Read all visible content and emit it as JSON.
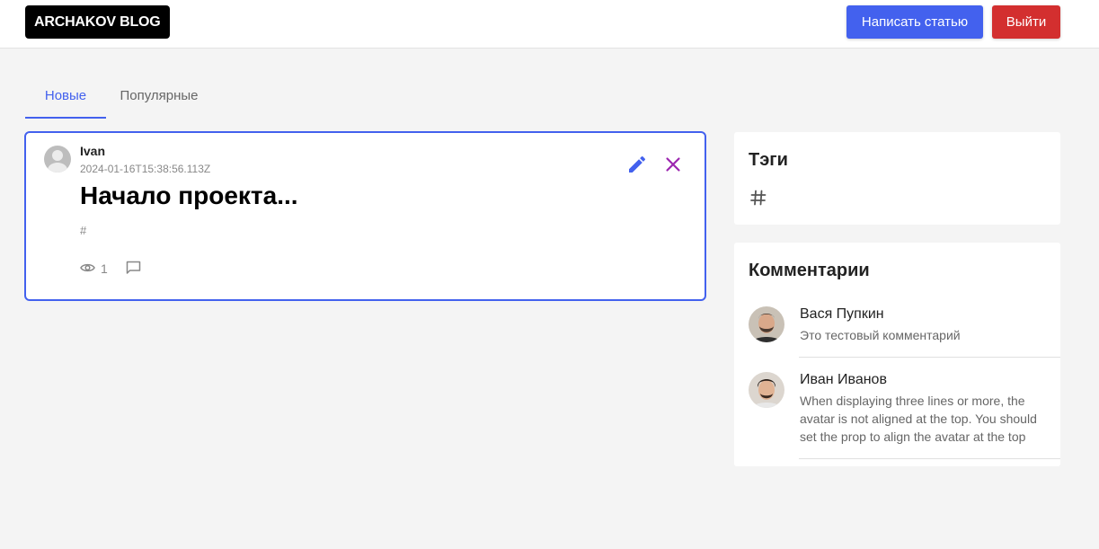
{
  "header": {
    "logo": "ARCHAKOV BLOG",
    "write_label": "Написать статью",
    "logout_label": "Выйти",
    "colors": {
      "primary": "#4361ee",
      "danger": "#d32f2f"
    }
  },
  "tabs": [
    {
      "label": "Новые",
      "active": true
    },
    {
      "label": "Популярные",
      "active": false
    }
  ],
  "post": {
    "author": "Ivan",
    "date": "2024-01-16T15:38:56.113Z",
    "title": "Начало проекта...",
    "tag": "#",
    "views": "1",
    "icons": [
      "avatar-icon",
      "edit-icon",
      "close-icon",
      "eye-icon",
      "comment-icon"
    ]
  },
  "sidebar": {
    "tags_title": "Тэги",
    "tags": [
      "#"
    ],
    "comments_title": "Комментарии",
    "comments": [
      {
        "name": "Вася Пупкин",
        "text": "Это тестовый комментарий"
      },
      {
        "name": "Иван Иванов",
        "text": "When displaying three lines or more, the avatar is not aligned at the top. You should set the prop to align the avatar at the top"
      }
    ]
  }
}
